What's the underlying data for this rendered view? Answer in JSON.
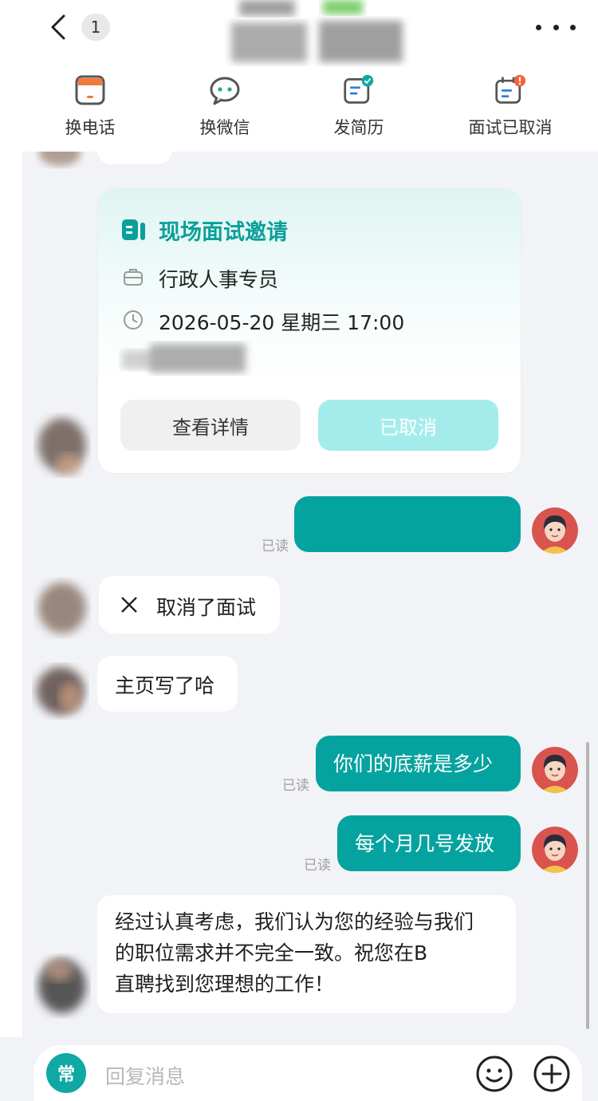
{
  "header": {
    "unread_count": "1",
    "actions": [
      {
        "label": "换电话",
        "icon": "phone-icon"
      },
      {
        "label": "换微信",
        "icon": "wechat-icon"
      },
      {
        "label": "发简历",
        "icon": "resume-icon"
      },
      {
        "label": "面试已取消",
        "icon": "calendar-alert-icon"
      }
    ]
  },
  "invite_card": {
    "title": "现场面试邀请",
    "position": "行政人事专员",
    "datetime": "2026-05-20 星期三 17:00",
    "detail_button": "查看详情",
    "status_button": "已取消"
  },
  "messages": {
    "read_label": "已读",
    "cancel_notice": "取消了面试",
    "recruiter_reply": "主页写了哈",
    "my_question_1": "你们的底薪是多少",
    "my_question_2": "每个月几号发放",
    "rejection_line1": "经过认真考虑，我们认为您的经验与我们",
    "rejection_line2": "的职位需求并不完全一致。祝您在B",
    "rejection_line3": "直聘找到您理想的工作！"
  },
  "input": {
    "common_phrase_label": "常",
    "placeholder": "回复消息"
  },
  "colors": {
    "accent": "#05a39f",
    "chat_bg": "#f2f3f7",
    "cancelled_button": "#a4ecec"
  }
}
